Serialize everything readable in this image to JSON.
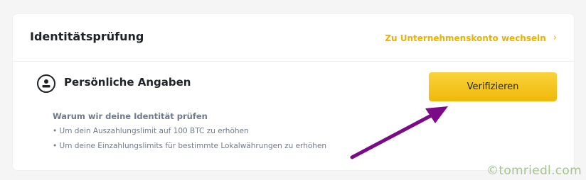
{
  "card": {
    "title": "Identitätsprüfung",
    "switch_link": "Zu Unternehmenskonto wechseln",
    "switch_chevron": "›"
  },
  "personal": {
    "title": "Persönliche Angaben",
    "icon": "user-id-icon",
    "verify_label": "Verifizieren",
    "why_title": "Warum wir deine Identität prüfen",
    "reasons": [
      "Um dein Auszahlungslimit auf 100 BTC zu erhöhen",
      "Um deine Einzahlungslimits für bestimmte Lokalwährungen zu erhöhen"
    ]
  },
  "annotation": {
    "arrow_color": "#7b0a86"
  },
  "watermark": "©tomriedl.com",
  "colors": {
    "accent": "#f0b90b",
    "link": "#e8b400",
    "text": "#1e2329",
    "muted": "#707a8a"
  }
}
